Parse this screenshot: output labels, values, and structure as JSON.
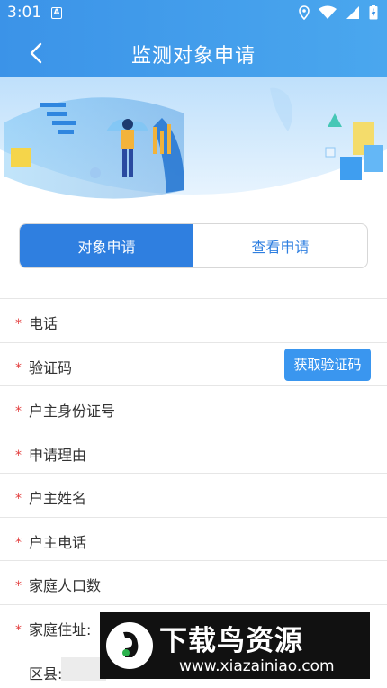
{
  "status": {
    "time": "3:01",
    "a_icon": "A"
  },
  "header": {
    "title": "监测对象申请"
  },
  "tabs": [
    {
      "label": "对象申请",
      "active": true
    },
    {
      "label": "查看申请",
      "active": false
    }
  ],
  "form": {
    "rows": [
      {
        "label": "电话",
        "required": true
      },
      {
        "label": "验证码",
        "required": true
      },
      {
        "label": "户主身份证号",
        "required": true
      },
      {
        "label": "申请理由",
        "required": true
      },
      {
        "label": "户主姓名",
        "required": true
      },
      {
        "label": "户主电话",
        "required": true
      },
      {
        "label": "家庭人口数",
        "required": true
      },
      {
        "label": "家庭住址:",
        "required": true
      }
    ],
    "required_mark": "*",
    "get_code_label": "获取验证码",
    "county_label": "区县:"
  },
  "watermark": {
    "title": "下载鸟资源",
    "url": "www.xiazainiao.com"
  },
  "colors": {
    "primary": "#2f7fe0",
    "header": "#3b93e8",
    "required": "#e23b3b"
  }
}
